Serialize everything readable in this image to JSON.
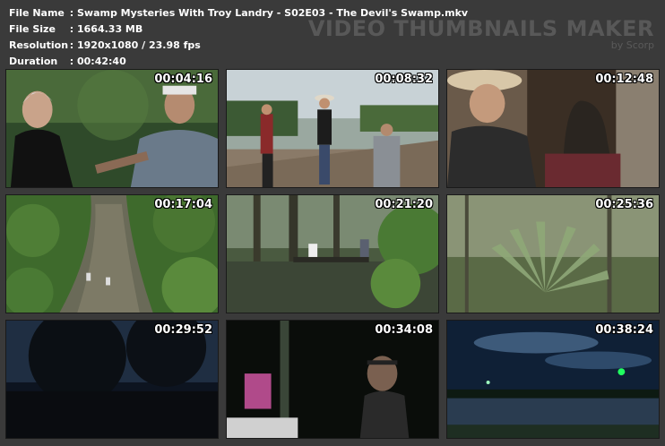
{
  "info": {
    "rows": [
      {
        "label": "File Name",
        "value": "Swamp Mysteries With Troy Landry - S02E03 - The Devil's Swamp.mkv"
      },
      {
        "label": "File Size",
        "value": "1664.33 MB"
      },
      {
        "label": "Resolution",
        "value": "1920x1080 / 23.98 fps"
      },
      {
        "label": "Duration",
        "value": "00:42:40"
      }
    ]
  },
  "brand": {
    "title": "VIDEO THUMBNAILS MAKER",
    "byline": "by Scorp"
  },
  "thumbnails": [
    {
      "timestamp": "00:04:16",
      "scene": "two-men-closeup"
    },
    {
      "timestamp": "00:08:32",
      "scene": "group-on-dock"
    },
    {
      "timestamp": "00:12:48",
      "scene": "men-at-cabin"
    },
    {
      "timestamp": "00:17:04",
      "scene": "aerial-bayou-boats"
    },
    {
      "timestamp": "00:21:20",
      "scene": "boat-in-cypress-swamp"
    },
    {
      "timestamp": "00:25:36",
      "scene": "palmetto-forest"
    },
    {
      "timestamp": "00:29:52",
      "scene": "dark-trees-night"
    },
    {
      "timestamp": "00:34:08",
      "scene": "night-headlamp"
    },
    {
      "timestamp": "00:38:24",
      "scene": "night-sky-water"
    }
  ]
}
